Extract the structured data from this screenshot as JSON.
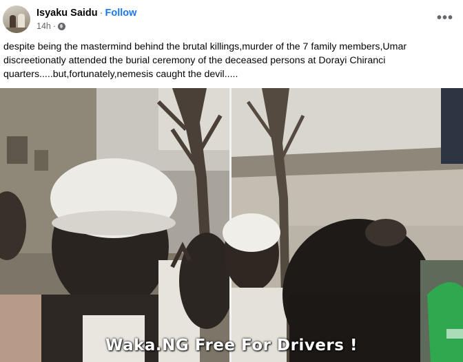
{
  "post": {
    "author": "Isyaku Saidu",
    "separator": "·",
    "follow_label": "Follow",
    "timestamp": "14h",
    "audience_icon": "globe-icon",
    "more_icon": "more-options-icon",
    "more_label": "•••",
    "caption": "despite being the mastermind behind the brutal killings,murder of the 7 family members,Umar discreetionatly attended the burial ceremony of the deceased persons at Dorayi Chiranci quarters.....but,fortunately,nemesis caught the devil....."
  },
  "media": {
    "watermark": "Waka.NG Free For Drivers !"
  },
  "colors": {
    "link_blue": "#1877f2",
    "secondary_text": "#65676b",
    "primary_text": "#050505"
  }
}
